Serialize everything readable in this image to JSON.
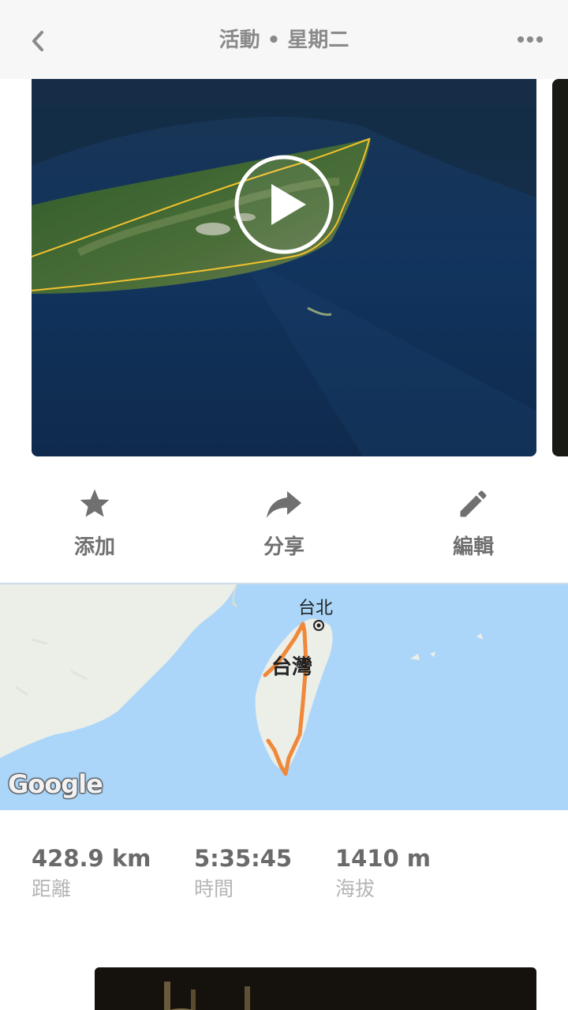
{
  "header": {
    "title": "活動 • 星期二"
  },
  "actions": {
    "add_label": "添加",
    "share_label": "分享",
    "edit_label": "編輯"
  },
  "map": {
    "city_label": "台北",
    "island_label": "台灣",
    "attribution": "Google"
  },
  "stats": [
    {
      "value": "428.9 km",
      "name": "距離"
    },
    {
      "value": "5:35:45",
      "name": "時間"
    },
    {
      "value": "1410 m",
      "name": "海拔"
    }
  ],
  "colors": {
    "route": "#f0883a",
    "sea": "#abd6f9",
    "land": "#eceee8",
    "text_muted": "#b5b5b5"
  }
}
